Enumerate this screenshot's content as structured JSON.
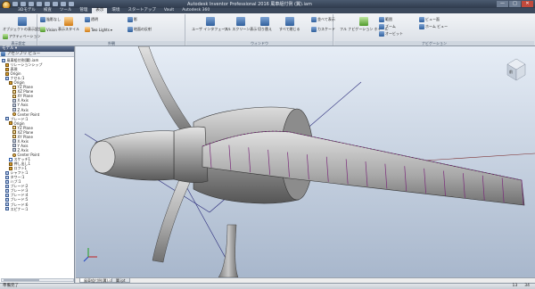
{
  "window": {
    "title": "Autodesk Inventor Professional 2016   風車組付例 (翼).iam",
    "controls": [
      "—",
      "□",
      "✕"
    ]
  },
  "ribbon_tabs": [
    "3Dモデル",
    "検査",
    "ツール",
    "管理",
    "表示",
    "環境",
    "スタートアップ",
    "Vault",
    "Autodesk 360"
  ],
  "active_tab_index": 4,
  "ribbon": {
    "panels": [
      {
        "label": "表示設定",
        "buttons": [
          "オブジェクトの表示設定",
          "アクティベーション"
        ]
      },
      {
        "label": "外観",
        "buttons": [
          "表示スタイル",
          "陰影なし",
          "Two Lights",
          "Vision",
          "影",
          "地面の反射",
          "透明"
        ]
      },
      {
        "label": "ウィンドウ",
        "buttons": [
          "ユーザ インタフェース",
          "フル スクリーン表示",
          "切り替え",
          "すべて閉じる",
          "並べて表示",
          "カスケード"
        ]
      },
      {
        "label": "ナビゲーション",
        "buttons": [
          "フル ナビゲーション ホイール",
          "範囲",
          "ズーム",
          "オービット",
          "ホーム ビュー",
          "ビュー面"
        ]
      }
    ]
  },
  "browser": {
    "title": "モデル ▾",
    "mode": "アセンブリ ビュー",
    "tree": [
      {
        "text": "風車組付例(翼).iam",
        "indent": 0,
        "icon": "assembly"
      },
      {
        "text": "リレーションシップ",
        "indent": 1,
        "icon": "folder"
      },
      {
        "text": "表現",
        "indent": 1,
        "icon": "folder"
      },
      {
        "text": "Origin",
        "indent": 1,
        "icon": "folder"
      },
      {
        "text": "ナセル:1",
        "indent": 1,
        "icon": "part"
      },
      {
        "text": "Origin",
        "indent": 2,
        "icon": "folder"
      },
      {
        "text": "YZ Plane",
        "indent": 3,
        "icon": "plane"
      },
      {
        "text": "XZ Plane",
        "indent": 3,
        "icon": "plane"
      },
      {
        "text": "XY Plane",
        "indent": 3,
        "icon": "plane"
      },
      {
        "text": "X Axis",
        "indent": 3,
        "icon": "axis"
      },
      {
        "text": "Y Axis",
        "indent": 3,
        "icon": "axis"
      },
      {
        "text": "Z Axis",
        "indent": 3,
        "icon": "axis"
      },
      {
        "text": "Center Point",
        "indent": 3,
        "icon": "point"
      },
      {
        "text": "ブレード:1",
        "indent": 1,
        "icon": "part"
      },
      {
        "text": "Origin",
        "indent": 2,
        "icon": "folder"
      },
      {
        "text": "YZ Plane",
        "indent": 3,
        "icon": "plane"
      },
      {
        "text": "XZ Plane",
        "indent": 3,
        "icon": "plane"
      },
      {
        "text": "XY Plane",
        "indent": 3,
        "icon": "plane"
      },
      {
        "text": "X Axis",
        "indent": 3,
        "icon": "axis"
      },
      {
        "text": "Y Axis",
        "indent": 3,
        "icon": "axis"
      },
      {
        "text": "Z Axis",
        "indent": 3,
        "icon": "axis"
      },
      {
        "text": "Center Point",
        "indent": 3,
        "icon": "point"
      },
      {
        "text": "スケッチ1",
        "indent": 2,
        "icon": "sketch"
      },
      {
        "text": "押し出し1",
        "indent": 2,
        "icon": "feature"
      },
      {
        "text": "ロフト1",
        "indent": 2,
        "icon": "feature"
      },
      {
        "text": "シャフト:1",
        "indent": 1,
        "icon": "part"
      },
      {
        "text": "タワー:1",
        "indent": 1,
        "icon": "part"
      },
      {
        "text": "ハブ:1",
        "indent": 1,
        "icon": "part"
      },
      {
        "text": "ブレード:2",
        "indent": 1,
        "icon": "part"
      },
      {
        "text": "ブレード:3",
        "indent": 1,
        "icon": "part"
      },
      {
        "text": "ブレード:4",
        "indent": 1,
        "icon": "part"
      },
      {
        "text": "ブレード:5",
        "indent": 1,
        "icon": "part"
      },
      {
        "text": "ブレード:6",
        "indent": 1,
        "icon": "part"
      },
      {
        "text": "スピナー:1",
        "indent": 1,
        "icon": "part"
      }
    ]
  },
  "document_tabs": [
    "風車組付例(翼).iam",
    "翼.ipt"
  ],
  "statusbar": {
    "message": "準備完了",
    "count_a": "13",
    "count_b": "34"
  },
  "viewcube_label": "前"
}
